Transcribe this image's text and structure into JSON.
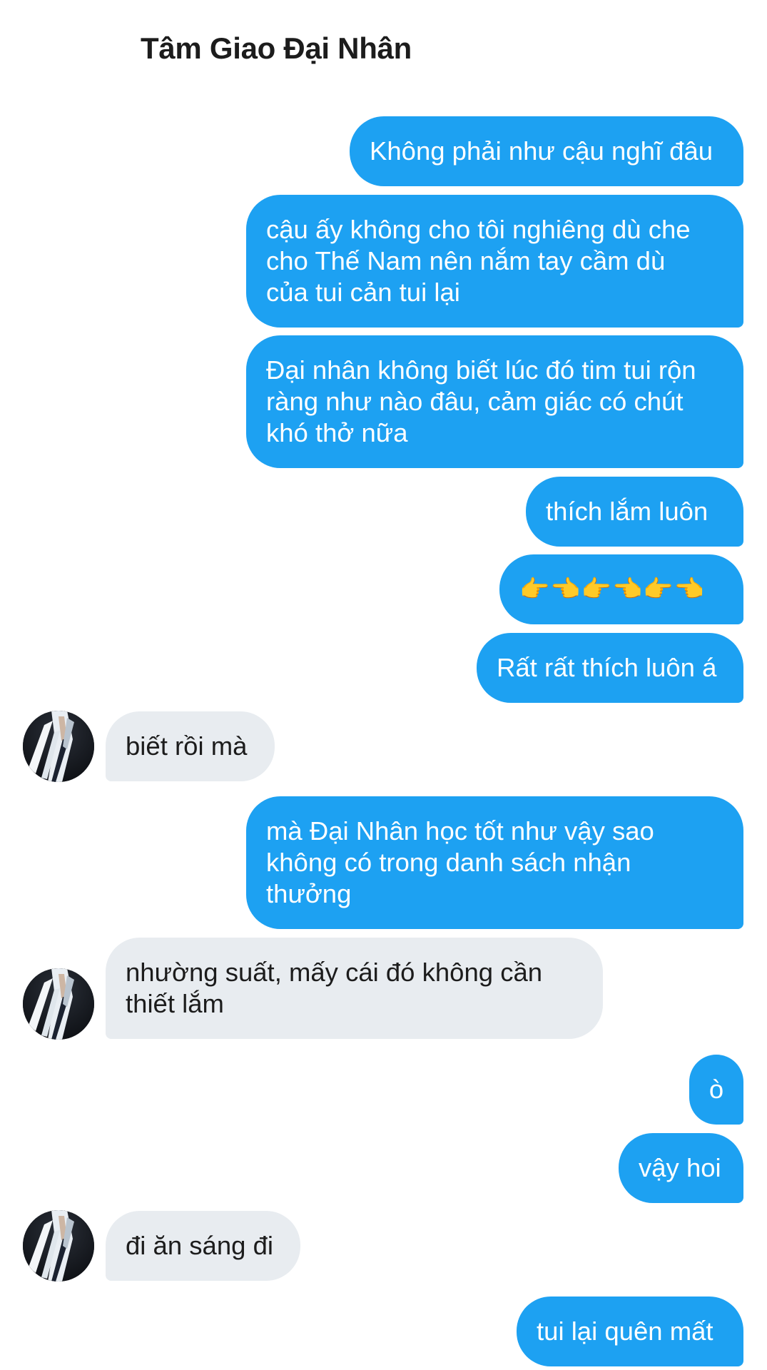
{
  "header": {
    "title": "Tâm Giao Đại Nhân"
  },
  "colors": {
    "outgoing_bubble": "#1da1f2",
    "incoming_bubble": "#e8ecf0",
    "outgoing_text": "#ffffff",
    "incoming_text": "#1c1c1c"
  },
  "messages": [
    {
      "direction": "outgoing",
      "lines": [
        "Không phải như cậu nghĩ đâu"
      ]
    },
    {
      "direction": "outgoing",
      "lines": [
        "cậu ấy không cho tôi nghiêng dù che",
        "cho Thế Nam nên nắm tay cầm dù",
        "của tui cản tui lại"
      ]
    },
    {
      "direction": "outgoing",
      "lines": [
        "Đại nhân không biết lúc đó tim tui rộn",
        "ràng như nào đâu, cảm giác có chút",
        "khó thở nữa"
      ]
    },
    {
      "direction": "outgoing",
      "lines": [
        "thích lắm luôn"
      ]
    },
    {
      "direction": "outgoing",
      "lines": [
        "👉👈👉👈👉👈"
      ]
    },
    {
      "direction": "outgoing",
      "lines": [
        "Rất rất thích luôn á"
      ]
    },
    {
      "direction": "incoming",
      "avatar": "contact-avatar",
      "lines": [
        "biết rồi mà"
      ]
    },
    {
      "direction": "outgoing",
      "lines": [
        "mà Đại Nhân học tốt như vậy sao",
        "không có trong danh sách nhận",
        "thưởng"
      ]
    },
    {
      "direction": "incoming",
      "avatar": "contact-avatar",
      "lines": [
        "nhường suất, mấy cái đó không cần",
        "thiết lắm"
      ]
    },
    {
      "direction": "outgoing",
      "lines": [
        "ò"
      ]
    },
    {
      "direction": "outgoing",
      "lines": [
        "vậy hoi"
      ]
    },
    {
      "direction": "incoming",
      "avatar": "contact-avatar",
      "lines": [
        "đi ăn sáng đi"
      ]
    },
    {
      "direction": "outgoing",
      "lines": [
        "tui lại quên mất"
      ]
    }
  ]
}
